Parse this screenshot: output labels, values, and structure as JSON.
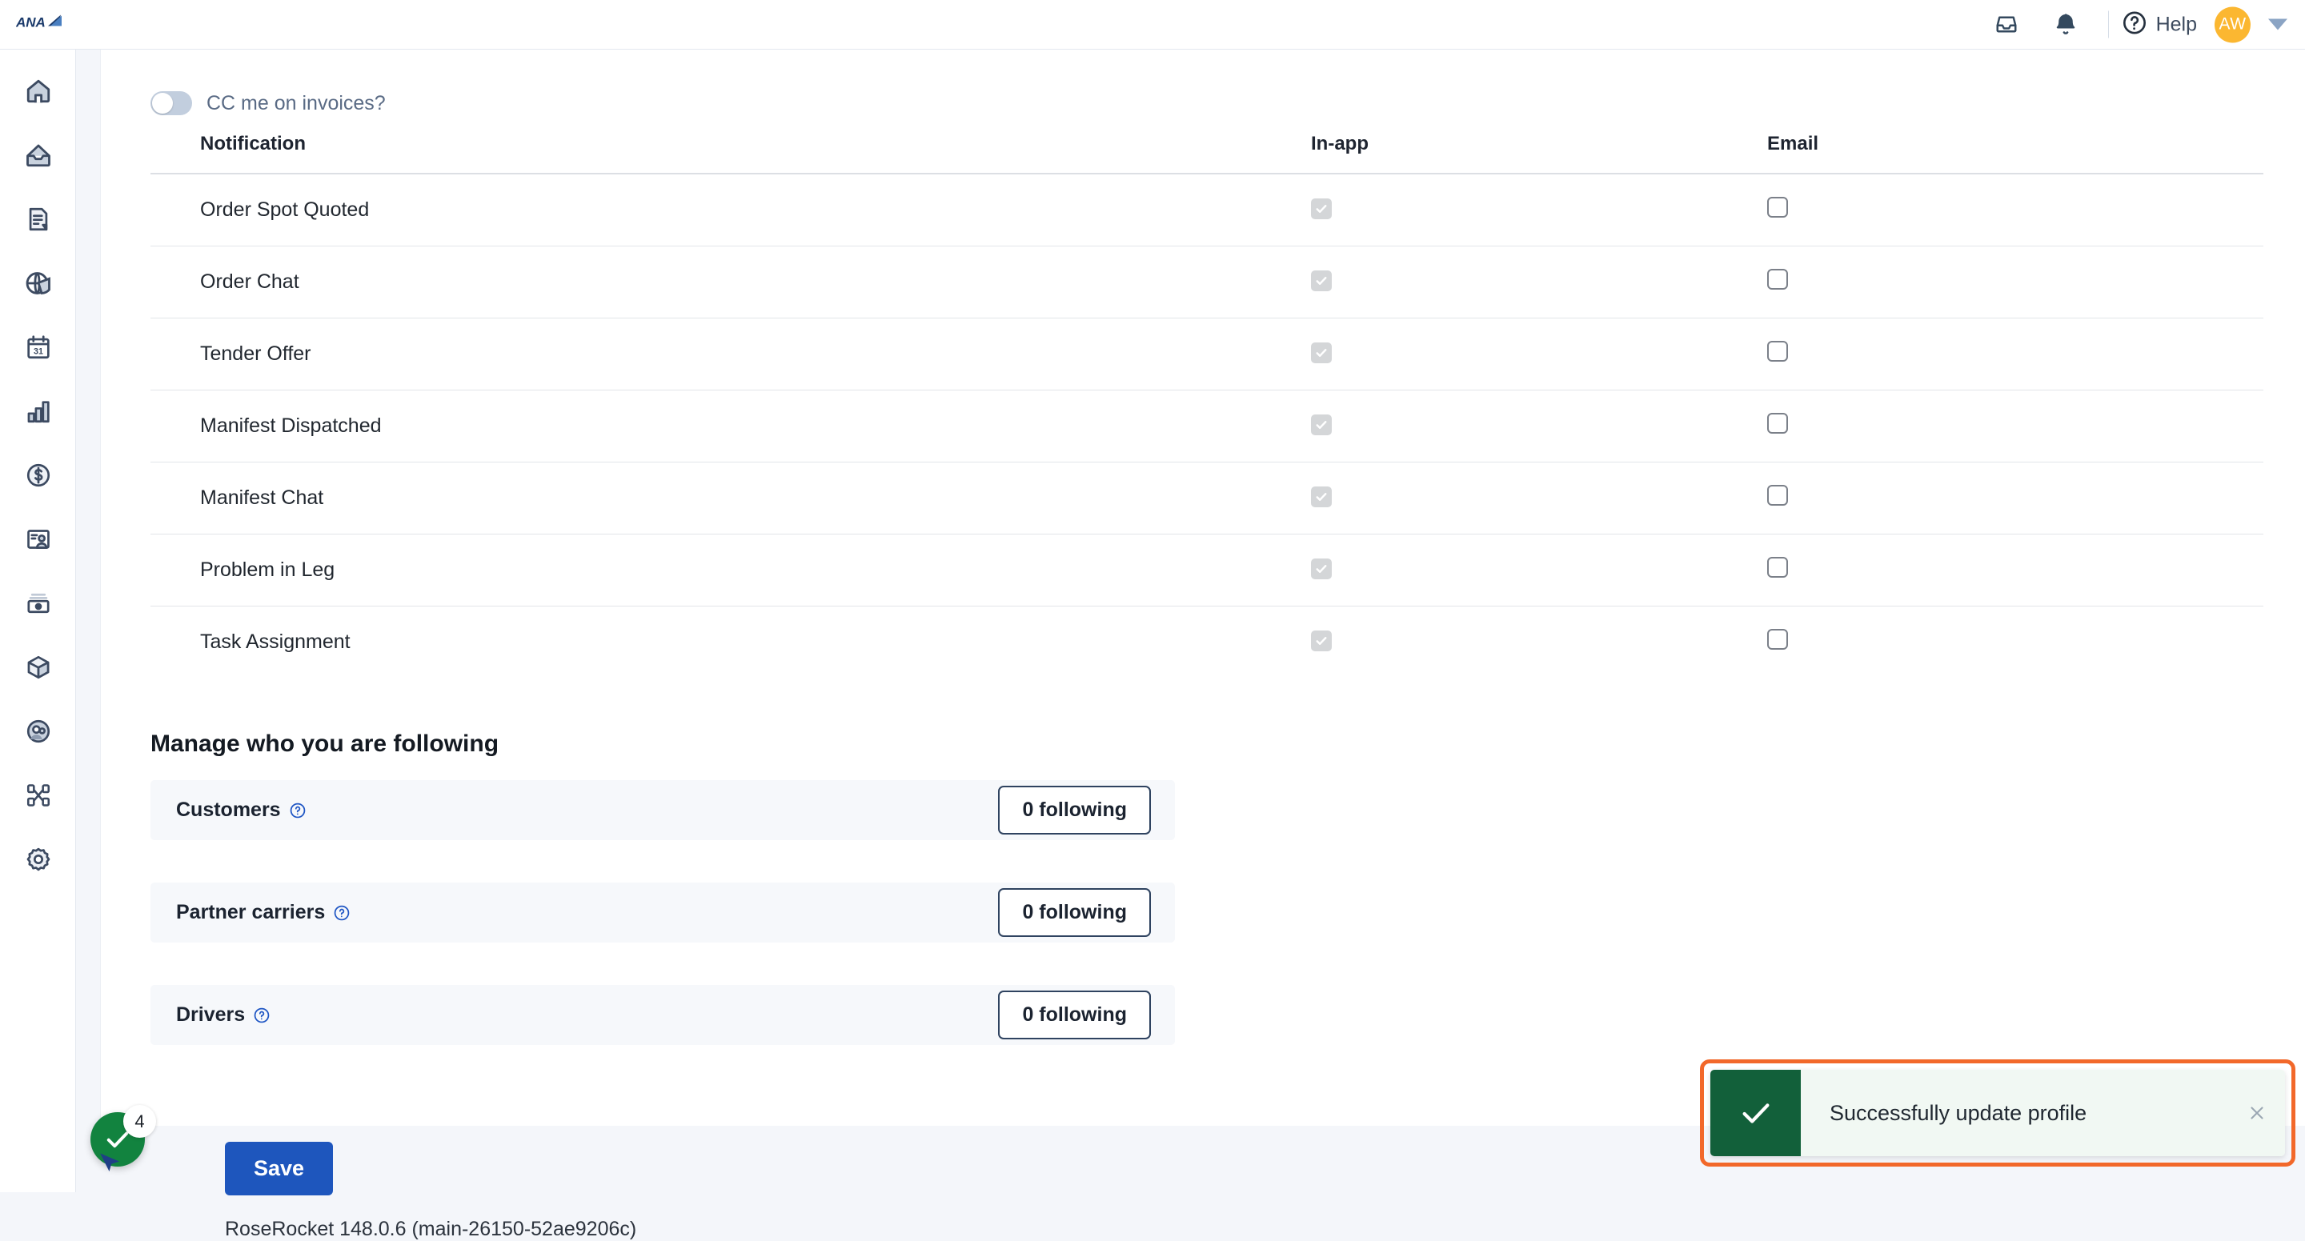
{
  "header": {
    "logo_text": "ANA",
    "inbox_icon": "inbox-icon",
    "bell_icon": "bell-icon",
    "help_icon": "help-circle-icon",
    "help_label": "Help",
    "avatar_initials": "AW",
    "avatar_color": "#FBB731",
    "chevron_icon": "chevron-down-icon"
  },
  "sidebar": {
    "items": [
      {
        "icon": "home-icon",
        "name": "home"
      },
      {
        "icon": "inbox-icon",
        "name": "inbox"
      },
      {
        "icon": "document-icon",
        "name": "orders"
      },
      {
        "icon": "globe-icon",
        "name": "dispatch"
      },
      {
        "icon": "calendar-icon",
        "name": "calendar"
      },
      {
        "icon": "bar-chart-icon",
        "name": "reports"
      },
      {
        "icon": "dollar-circle-icon",
        "name": "billing"
      },
      {
        "icon": "contact-card-icon",
        "name": "customers"
      },
      {
        "icon": "archive-icon",
        "name": "archive"
      },
      {
        "icon": "cube-icon",
        "name": "inventory"
      },
      {
        "icon": "people-icon",
        "name": "team"
      },
      {
        "icon": "network-icon",
        "name": "network"
      },
      {
        "icon": "gear-icon",
        "name": "settings"
      }
    ]
  },
  "settings": {
    "cc_toggle_label": "CC me on invoices?",
    "cc_toggle_state": "off",
    "table": {
      "columns": [
        "Notification",
        "In-app",
        "Email"
      ],
      "rows": [
        {
          "notification": "Order Spot Quoted",
          "in_app": true,
          "email": false
        },
        {
          "notification": "Order Chat",
          "in_app": true,
          "email": false
        },
        {
          "notification": "Tender Offer",
          "in_app": true,
          "email": false
        },
        {
          "notification": "Manifest Dispatched",
          "in_app": true,
          "email": false
        },
        {
          "notification": "Manifest Chat",
          "in_app": true,
          "email": false
        },
        {
          "notification": "Problem in Leg",
          "in_app": true,
          "email": false
        },
        {
          "notification": "Task Assignment",
          "in_app": true,
          "email": false
        }
      ]
    },
    "following_title": "Manage who you are following",
    "following": [
      {
        "label": "Customers",
        "button": "0 following",
        "help_icon": "question-circle-icon"
      },
      {
        "label": "Partner carriers",
        "button": "0 following",
        "help_icon": "question-circle-icon"
      },
      {
        "label": "Drivers",
        "button": "0 following",
        "help_icon": "question-circle-icon"
      }
    ],
    "save_label": "Save",
    "save_color": "#1E56BD",
    "version": "RoseRocket 148.0.6 (main-26150-52ae9206c)"
  },
  "fab": {
    "icon": "check-icon",
    "badge_count": "4",
    "color": "#12833F"
  },
  "toast": {
    "icon": "check-icon",
    "message": "Successfully update profile",
    "close_icon": "close-icon",
    "icon_bg": "#12603A",
    "body_bg": "#F1F8F3",
    "highlight_color": "#F2682A"
  }
}
